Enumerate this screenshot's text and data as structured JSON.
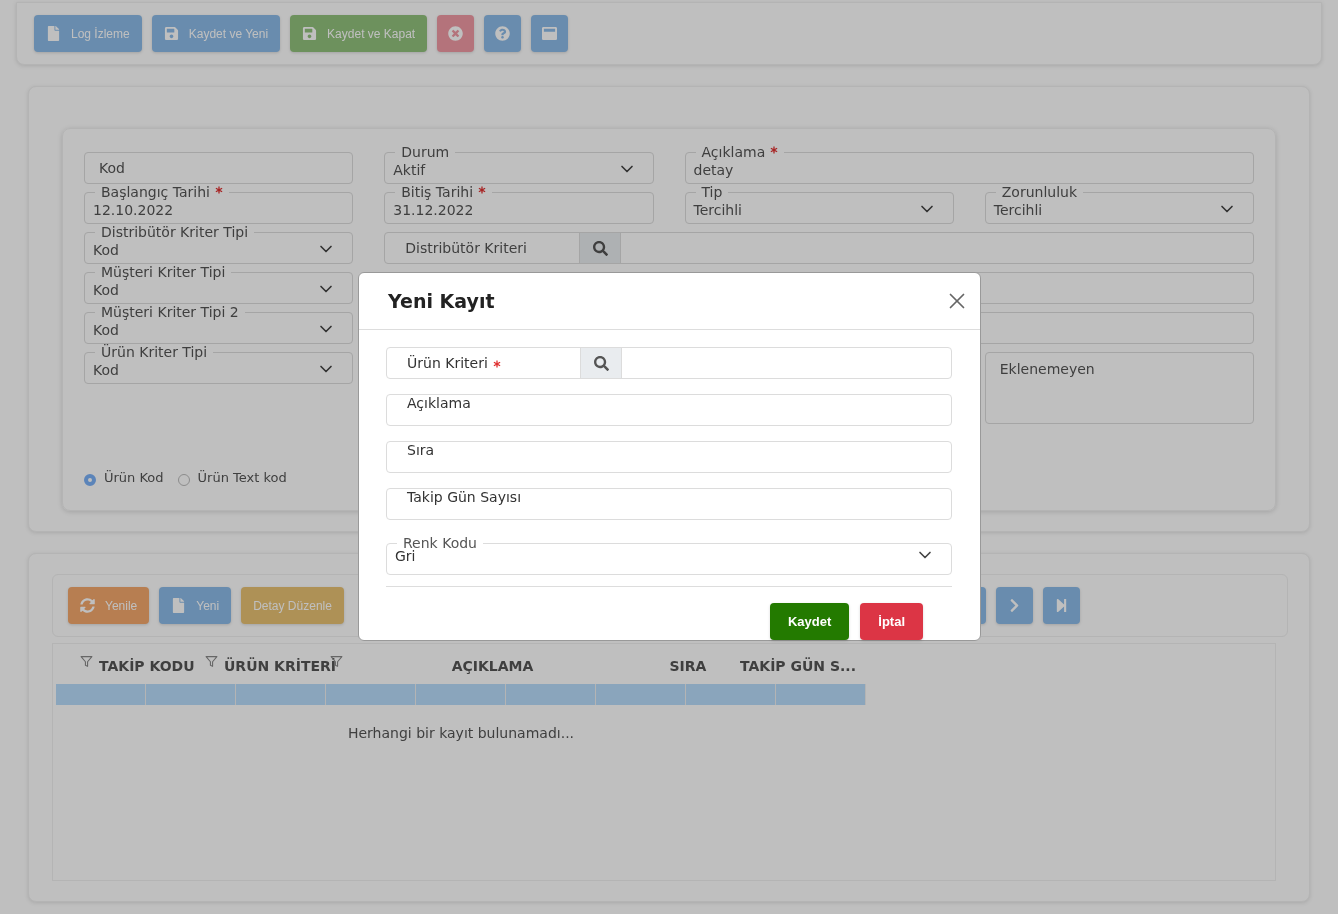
{
  "toolbar": {
    "buttons": [
      {
        "label": "Log İzleme"
      },
      {
        "label": "Kaydet ve Yeni"
      },
      {
        "label": "Kaydet ve Kapat"
      }
    ]
  },
  "form": {
    "fields": [
      {
        "kind": "text",
        "label": "Kod"
      },
      {
        "kind": "select",
        "label": "Durum",
        "value": "Aktif"
      },
      {
        "kind": "text",
        "label": "Açıklama",
        "required": true,
        "value": "detay"
      },
      {
        "kind": "text",
        "label": "Başlangıç Tarihi",
        "required": true,
        "value": "12.10.2022"
      },
      {
        "kind": "text",
        "label": "Bitiş Tarihi",
        "required": true,
        "value": "31.12.2022"
      },
      {
        "kind": "select",
        "label": "Tip",
        "value": "Tercihli"
      },
      {
        "kind": "select",
        "label": "Zorunluluk",
        "value": "Tercihli"
      },
      {
        "kind": "select",
        "label": "Distribütör Kriter Tipi",
        "value": "Kod"
      },
      {
        "kind": "lookup",
        "label": "Distribütör Kriteri"
      },
      {
        "kind": "select",
        "label": "Müşteri Kriter Tipi",
        "value": "Kod"
      },
      {
        "kind": "blank"
      },
      {
        "kind": "select",
        "label": "Müşteri Kriter Tipi 2",
        "value": "Kod"
      },
      {
        "kind": "blank"
      },
      {
        "kind": "select",
        "label": "Ürün Kriter Tipi",
        "value": "Kod"
      },
      {
        "kind": "textarea",
        "label": "Eklenemeyen"
      }
    ],
    "radios": [
      {
        "label": "Ürün Kod",
        "selected": true
      },
      {
        "label": "Ürün Text kod",
        "selected": false
      }
    ]
  },
  "grid": {
    "buttons": [
      {
        "label": "Yenile"
      },
      {
        "label": "Yeni"
      },
      {
        "label": "Detay Düzenle"
      }
    ],
    "columns": [
      {
        "label": "TAKİP KODU",
        "filter": true
      },
      {
        "label": "ÜRÜN KRİTERİ",
        "filter": true
      },
      {
        "label": "AÇIKLAMA",
        "filter": true
      },
      {
        "label": "SIRA",
        "filter": false
      },
      {
        "label": "TAKİP GÜN S...",
        "filter": false
      }
    ],
    "empty_message": "Herhangi bir kayıt bulunamadı..."
  },
  "modal": {
    "title": "Yeni Kayıt",
    "fields": [
      {
        "kind": "lookup",
        "label": "Ürün Kriteri",
        "required": true
      },
      {
        "kind": "text",
        "label": "Açıklama"
      },
      {
        "kind": "text",
        "label": "Sıra"
      },
      {
        "kind": "text",
        "label": "Takip Gün Sayısı"
      },
      {
        "kind": "select",
        "label": "Renk Kodu",
        "value": "Gri"
      }
    ],
    "buttons": [
      {
        "label": "Kaydet"
      },
      {
        "label": "İptal"
      }
    ]
  }
}
